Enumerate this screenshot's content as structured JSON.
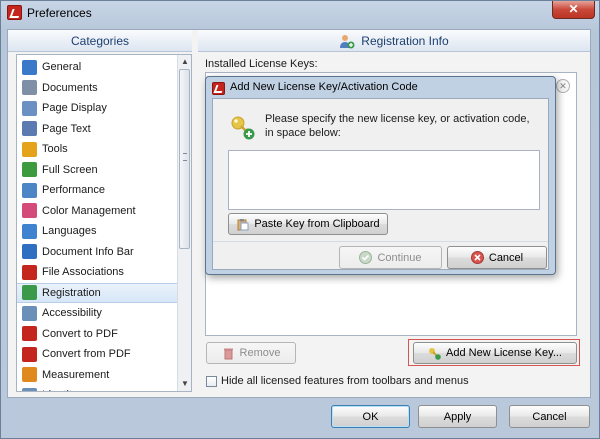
{
  "window": {
    "title": "Preferences",
    "close_glyph": "✕"
  },
  "categories": {
    "header": "Categories",
    "items": [
      {
        "label": "General",
        "icon": "general-icon",
        "color": "#3a78c9"
      },
      {
        "label": "Documents",
        "icon": "documents-icon",
        "color": "#7f8fa6"
      },
      {
        "label": "Page Display",
        "icon": "page-display-icon",
        "color": "#6b90c4"
      },
      {
        "label": "Page Text",
        "icon": "page-text-icon",
        "color": "#5b7bb0"
      },
      {
        "label": "Tools",
        "icon": "tools-icon",
        "color": "#e5a21b"
      },
      {
        "label": "Full Screen",
        "icon": "full-screen-icon",
        "color": "#3d9a3d"
      },
      {
        "label": "Performance",
        "icon": "performance-icon",
        "color": "#4d86c6"
      },
      {
        "label": "Color Management",
        "icon": "color-management-icon",
        "color": "#d44a7a"
      },
      {
        "label": "Languages",
        "icon": "languages-icon",
        "color": "#3f82cf"
      },
      {
        "label": "Document Info Bar",
        "icon": "info-icon",
        "color": "#2f6fc1"
      },
      {
        "label": "File Associations",
        "icon": "pdf-icon",
        "color": "#c4261d"
      },
      {
        "label": "Registration",
        "icon": "registration-icon",
        "color": "#3a9a4a"
      },
      {
        "label": "Accessibility",
        "icon": "accessibility-icon",
        "color": "#6a8fb8"
      },
      {
        "label": "Convert to PDF",
        "icon": "convert-to-pdf-icon",
        "color": "#c4261d"
      },
      {
        "label": "Convert from PDF",
        "icon": "convert-from-pdf-icon",
        "color": "#c4261d"
      },
      {
        "label": "Measurement",
        "icon": "measurement-icon",
        "color": "#e08a1e"
      },
      {
        "label": "Identity",
        "icon": "identity-icon",
        "color": "#6a8fb8"
      }
    ],
    "selected": "Registration"
  },
  "registration": {
    "header": "Registration Info",
    "installed_label": "Installed License Keys:",
    "remove_label": "Remove",
    "add_label": "Add New License Key...",
    "hide_label": "Hide all licensed features from toolbars and menus"
  },
  "dialog": {
    "title": "Add New License Key/Activation Code",
    "message": "Please specify the new license key, or activation code, in space below:",
    "input_value": "",
    "paste_label": "Paste Key from Clipboard",
    "continue_label": "Continue",
    "cancel_label": "Cancel"
  },
  "footer": {
    "ok_label": "OK",
    "apply_label": "Apply",
    "cancel_label": "Cancel"
  }
}
